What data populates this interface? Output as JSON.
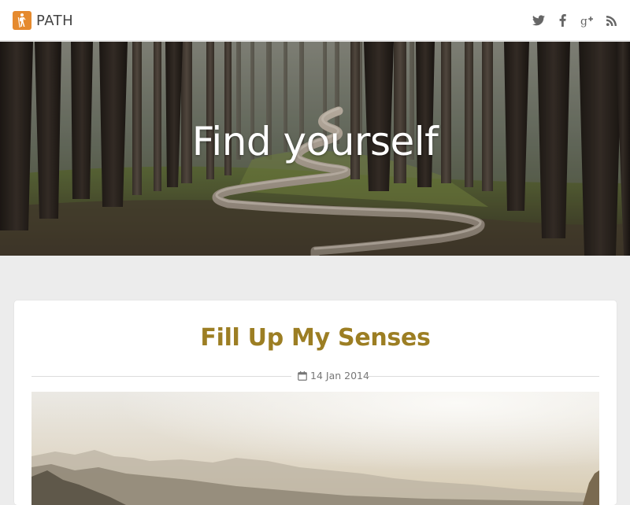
{
  "brand": {
    "name": "PATH",
    "logo": "hiker-icon",
    "logo_color": "#e58a2e"
  },
  "social": [
    {
      "name": "twitter",
      "icon": "twitter-icon"
    },
    {
      "name": "facebook",
      "icon": "facebook-icon"
    },
    {
      "name": "google-plus",
      "icon": "google-plus-icon"
    },
    {
      "name": "rss",
      "icon": "rss-icon"
    }
  ],
  "hero": {
    "title": "Find yourself"
  },
  "post": {
    "title": "Fill Up My Senses",
    "date": "14 Jan 2014",
    "title_color": "#9c7e23"
  }
}
